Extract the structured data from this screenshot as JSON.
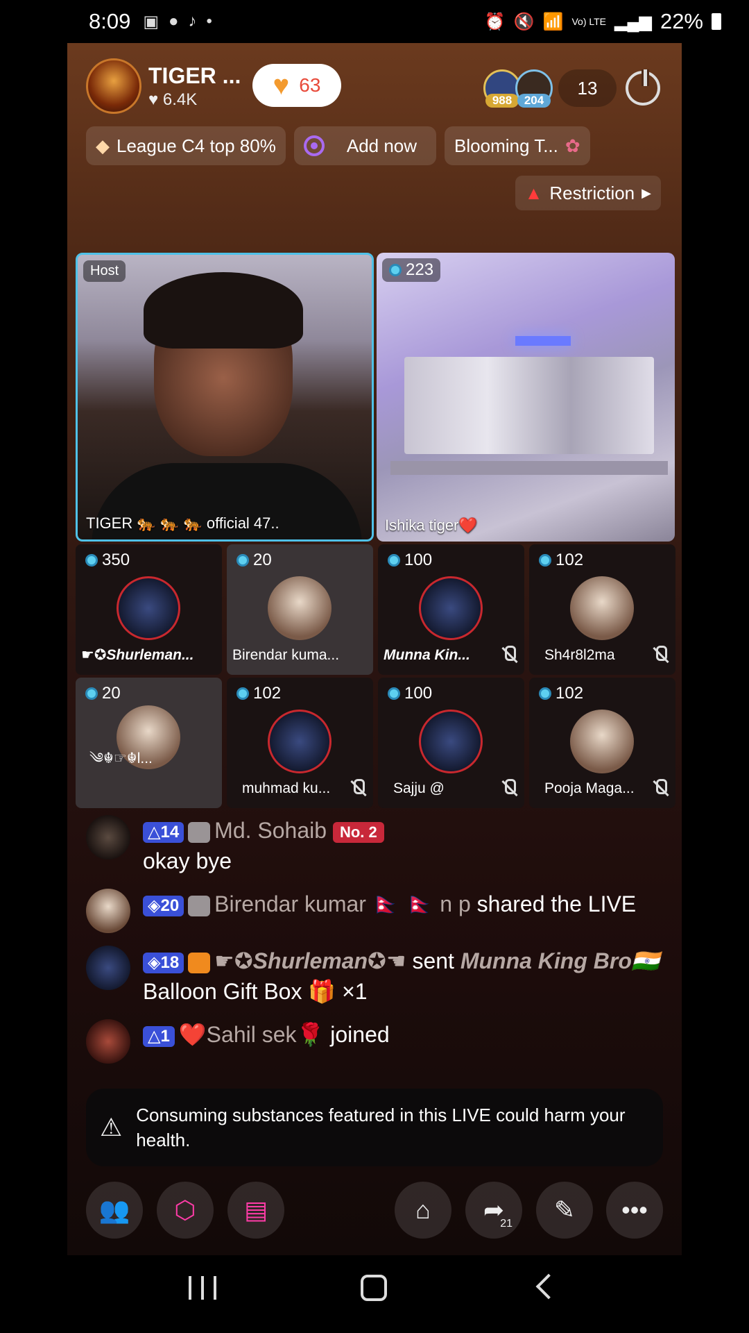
{
  "status_bar": {
    "time": "8:09",
    "network": "Vo) LTE",
    "battery": "22%"
  },
  "header": {
    "host_name": "TIGER ...",
    "host_likes": "♥ 6.4K",
    "hearts_count": "63",
    "viewer_badges": [
      "988",
      "204"
    ],
    "viewer_count": "13"
  },
  "badges": {
    "league": "League C4 top 80%",
    "add_now": "Add now",
    "blooming": "Blooming T...",
    "restriction": "Restriction"
  },
  "stage": {
    "host_tag": "Host",
    "host_name": "TIGER 🐅 🐅 🐅 official 47..",
    "guest_score": "223",
    "guest_name": "Ishika tiger❤️"
  },
  "seats": [
    {
      "score": "350",
      "name": "☛✪Shurleman..."
    },
    {
      "score": "20",
      "name": "Birendar kuma..."
    },
    {
      "score": "100",
      "name": "Munna Kin..."
    },
    {
      "score": "102",
      "name": "Sh4r8l2ma"
    },
    {
      "score": "20",
      "name": "༄☬☞☬l..."
    },
    {
      "score": "102",
      "name": "muhmad ku..."
    },
    {
      "score": "100",
      "name": "Sajju @"
    },
    {
      "score": "102",
      "name": "Pooja Maga..."
    }
  ],
  "chat": [
    {
      "level": "14",
      "user": "Md. Sohaib",
      "badge": "No. 2",
      "text": "okay bye"
    },
    {
      "level": "20",
      "user": "Birendar kumar 🇳🇵 🇳🇵 n p",
      "text": "shared the LIVE"
    },
    {
      "level": "18",
      "user": "☛✪Shurleman✪☚",
      "text_a": "sent",
      "target": "Munna King Bro🇮🇳",
      "text_b": "Balloon Gift Box 🎁 ×1"
    },
    {
      "level": "1",
      "user": "❤️Sahil sek🌹",
      "text": "joined"
    }
  ],
  "warning": "Consuming substances featured in this LIVE could harm your health.",
  "toolbar": {
    "share_count": "21"
  }
}
